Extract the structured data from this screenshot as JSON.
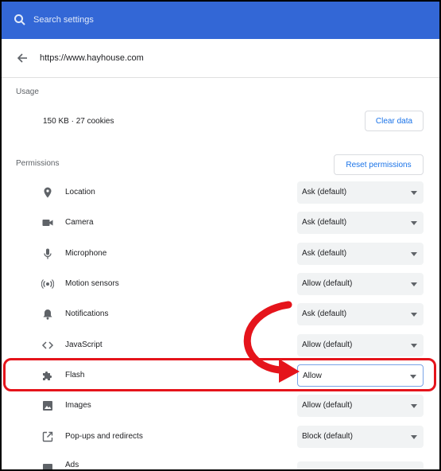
{
  "search": {
    "placeholder": "Search settings"
  },
  "site": {
    "url": "https://www.hayhouse.com"
  },
  "usage": {
    "title": "Usage",
    "summary": "150 KB · 27 cookies",
    "clear_label": "Clear data"
  },
  "permissions": {
    "title": "Permissions",
    "reset_label": "Reset permissions",
    "items": [
      {
        "label": "Location",
        "value": "Ask (default)",
        "icon": "location-icon"
      },
      {
        "label": "Camera",
        "value": "Ask (default)",
        "icon": "camera-icon"
      },
      {
        "label": "Microphone",
        "value": "Ask (default)",
        "icon": "microphone-icon"
      },
      {
        "label": "Motion sensors",
        "value": "Allow (default)",
        "icon": "motion-sensors-icon"
      },
      {
        "label": "Notifications",
        "value": "Ask (default)",
        "icon": "bell-icon"
      },
      {
        "label": "JavaScript",
        "value": "Allow (default)",
        "icon": "code-icon"
      },
      {
        "label": "Flash",
        "value": "Allow",
        "icon": "puzzle-icon"
      },
      {
        "label": "Images",
        "value": "Allow (default)",
        "icon": "image-icon"
      },
      {
        "label": "Pop-ups and redirects",
        "value": "Block (default)",
        "icon": "popup-icon"
      },
      {
        "label": "Ads",
        "value": "",
        "icon": "ads-icon"
      }
    ]
  },
  "colors": {
    "accent": "#3367d6",
    "highlight": "#e5141b",
    "link": "#1a73e8"
  }
}
